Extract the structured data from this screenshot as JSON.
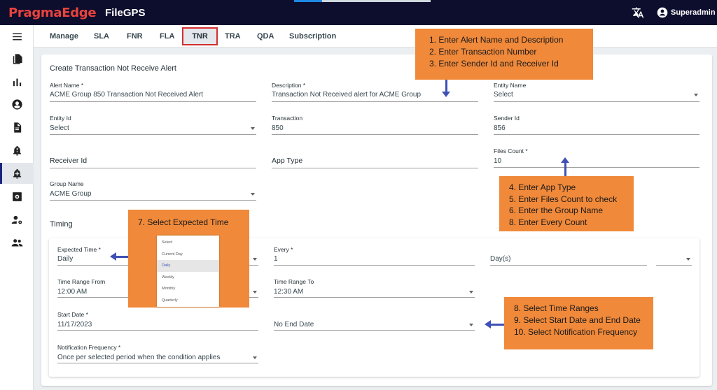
{
  "app": {
    "brand": "PragmaEdge",
    "product": "FileGPS",
    "user": "Superadmin"
  },
  "colors": {
    "topbar": "#0d0d2e",
    "brand_red": "#e8433c",
    "callout": "#f0893a",
    "arrow": "#3f51b5",
    "active_tab_border": "#d32f2f"
  },
  "sidebar": {
    "items": [
      {
        "icon": "menu-icon"
      },
      {
        "icon": "files-icon"
      },
      {
        "icon": "bar-chart-icon"
      },
      {
        "icon": "account-circle-icon"
      },
      {
        "icon": "document-icon"
      },
      {
        "icon": "alert-bell-icon"
      },
      {
        "icon": "add-alert-icon"
      },
      {
        "icon": "settings-box-icon"
      },
      {
        "icon": "user-settings-icon"
      },
      {
        "icon": "group-icon"
      }
    ]
  },
  "tabs": [
    "Manage",
    "SLA",
    "FNR",
    "FLA",
    "TNR",
    "TRA",
    "QDA",
    "Subscription"
  ],
  "form": {
    "title": "Create Transaction Not Receive Alert",
    "alert_name": {
      "label": "Alert Name *",
      "value": "ACME Group 850 Transaction Not Received Alert"
    },
    "description": {
      "label": "Description *",
      "value": "Transaction Not Received alert for ACME Group"
    },
    "entity_name": {
      "label": "Entity Name",
      "value": "Select"
    },
    "entity_id": {
      "label": "Entity Id",
      "value": "Select"
    },
    "transaction": {
      "label": "Transaction",
      "value": "850"
    },
    "sender_id": {
      "label": "Sender Id",
      "value": "856"
    },
    "receiver_id": {
      "label": "Receiver Id"
    },
    "app_type": {
      "label": "App Type"
    },
    "files_count": {
      "label": "Files Count *",
      "value": "10"
    },
    "group_name": {
      "label": "Group Name",
      "value": "ACME Group"
    }
  },
  "timing": {
    "title": "Timing",
    "expected_time": {
      "label": "Expected Time *",
      "value": "Daily"
    },
    "every": {
      "label": "Every *",
      "value": "1"
    },
    "period_unit": {
      "value": "Day(s)"
    },
    "time_range_from": {
      "label": "Time Range From",
      "value": "12:00 AM"
    },
    "time_range_to": {
      "label": "Time Range To",
      "value": "12:30 AM"
    },
    "start_date": {
      "label": "Start Date *",
      "value": "11/17/2023"
    },
    "end_date": {
      "value": "No End Date"
    },
    "notification_frequency": {
      "label": "Notification Frequency *",
      "value": "Once per selected period when the condition applies"
    }
  },
  "callouts": {
    "top": [
      "1. Enter Alert Name and Description",
      "2. Enter Transaction Number",
      "3. Enter Sender Id and Receiver Id"
    ],
    "middle": [
      "4. Enter App Type",
      "5. Enter Files Count to check",
      "6. Enter the Group Name",
      "8. Enter Every Count"
    ],
    "expected": "7. Select Expected Time",
    "bottom": [
      "8. Select Time Ranges",
      "9. Select Start Date and End Date",
      "10. Select Notification Frequency"
    ]
  },
  "expected_dropdown": {
    "options": [
      "Select",
      "Current Day",
      "Daily",
      "Weekly",
      "Monthly",
      "Quarterly"
    ],
    "selected": "Daily"
  }
}
